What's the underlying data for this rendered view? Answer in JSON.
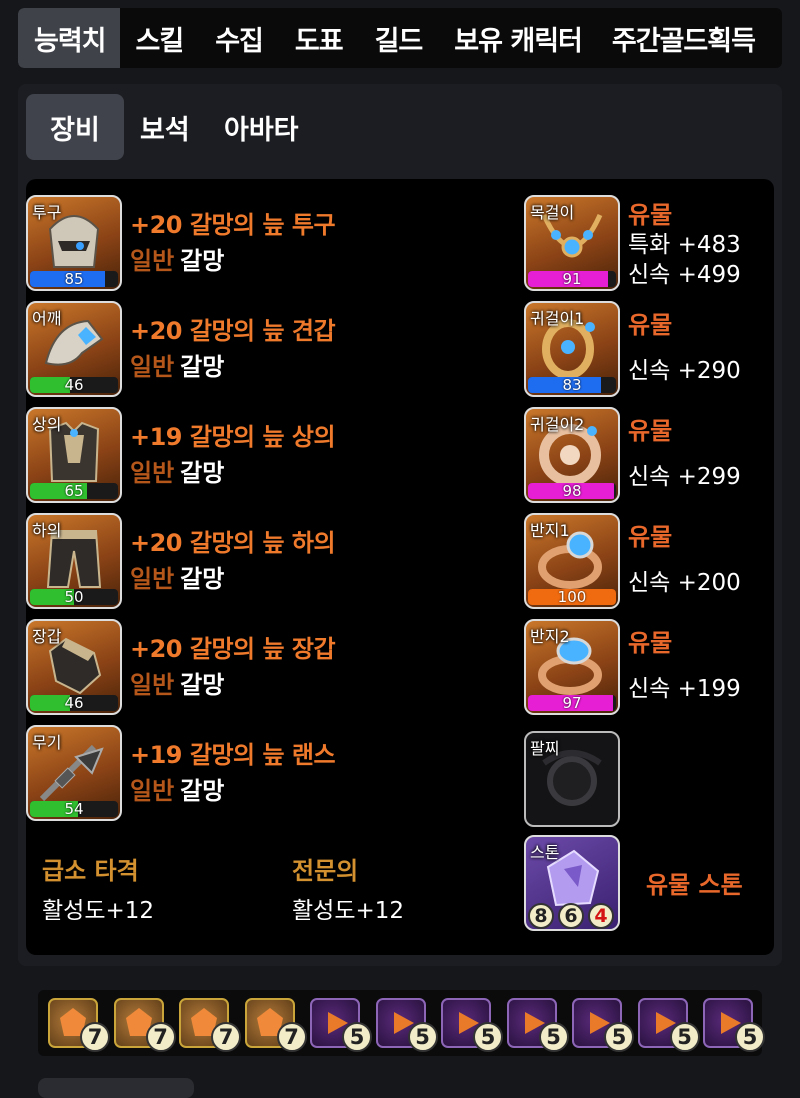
{
  "top_tabs": [
    "능력치",
    "스킬",
    "수집",
    "도표",
    "길드",
    "보유 캐릭터",
    "주간골드획득"
  ],
  "sub_tabs": [
    "장비",
    "보석",
    "아바타"
  ],
  "equipment": [
    {
      "slot": "투구",
      "name": "+20 갈망의 늪 투구",
      "grade": "일반",
      "set": "갈망",
      "quality": 85,
      "bar_color": "#1e6cf0"
    },
    {
      "slot": "어깨",
      "name": "+20 갈망의 늪 견갑",
      "grade": "일반",
      "set": "갈망",
      "quality": 46,
      "bar_color": "#2fbf2f"
    },
    {
      "slot": "상의",
      "name": "+19 갈망의 늪 상의",
      "grade": "일반",
      "set": "갈망",
      "quality": 65,
      "bar_color": "#2fbf2f"
    },
    {
      "slot": "하의",
      "name": "+20 갈망의 늪 하의",
      "grade": "일반",
      "set": "갈망",
      "quality": 50,
      "bar_color": "#2fbf2f"
    },
    {
      "slot": "장갑",
      "name": "+20 갈망의 늪 장갑",
      "grade": "일반",
      "set": "갈망",
      "quality": 46,
      "bar_color": "#2fbf2f"
    },
    {
      "slot": "무기",
      "name": "+19 갈망의 늪 랜스",
      "grade": "일반",
      "set": "갈망",
      "quality": 54,
      "bar_color": "#2fbf2f"
    }
  ],
  "accessories": [
    {
      "slot": "목걸이",
      "grade": "유물",
      "stats": [
        "특화 +483",
        "신속 +499"
      ],
      "quality": 91,
      "bar_color": "#e61ed4"
    },
    {
      "slot": "귀걸이1",
      "grade": "유물",
      "stats": [
        "신속 +290"
      ],
      "quality": 83,
      "bar_color": "#1e6cf0"
    },
    {
      "slot": "귀걸이2",
      "grade": "유물",
      "stats": [
        "신속 +299"
      ],
      "quality": 98,
      "bar_color": "#e61ed4"
    },
    {
      "slot": "반지1",
      "grade": "유물",
      "stats": [
        "신속 +200"
      ],
      "quality": 100,
      "bar_color": "#f06a0f"
    },
    {
      "slot": "반지2",
      "grade": "유물",
      "stats": [
        "신속 +199"
      ],
      "quality": 97,
      "bar_color": "#e61ed4"
    }
  ],
  "bracelet": {
    "slot": "팔찌"
  },
  "stone": {
    "slot": "스톤",
    "label": "유물 스톤",
    "nodes": [
      "8",
      "6",
      "4"
    ]
  },
  "engravings": [
    {
      "name": "급소 타격",
      "value": "활성도+12"
    },
    {
      "name": "전문의",
      "value": "활성도+12"
    }
  ],
  "gems": [
    {
      "type": "red",
      "level": "7"
    },
    {
      "type": "red",
      "level": "7"
    },
    {
      "type": "red",
      "level": "7"
    },
    {
      "type": "red",
      "level": "7"
    },
    {
      "type": "purple",
      "level": "5"
    },
    {
      "type": "purple",
      "level": "5"
    },
    {
      "type": "purple",
      "level": "5"
    },
    {
      "type": "purple",
      "level": "5"
    },
    {
      "type": "purple",
      "level": "5"
    },
    {
      "type": "purple",
      "level": "5"
    },
    {
      "type": "purple",
      "level": "5"
    }
  ],
  "colors": {
    "accent_orange": "#f07a2c",
    "grade_brown": "#b5571b",
    "engrave_gold": "#d4912f",
    "relic": "#e8672a"
  }
}
